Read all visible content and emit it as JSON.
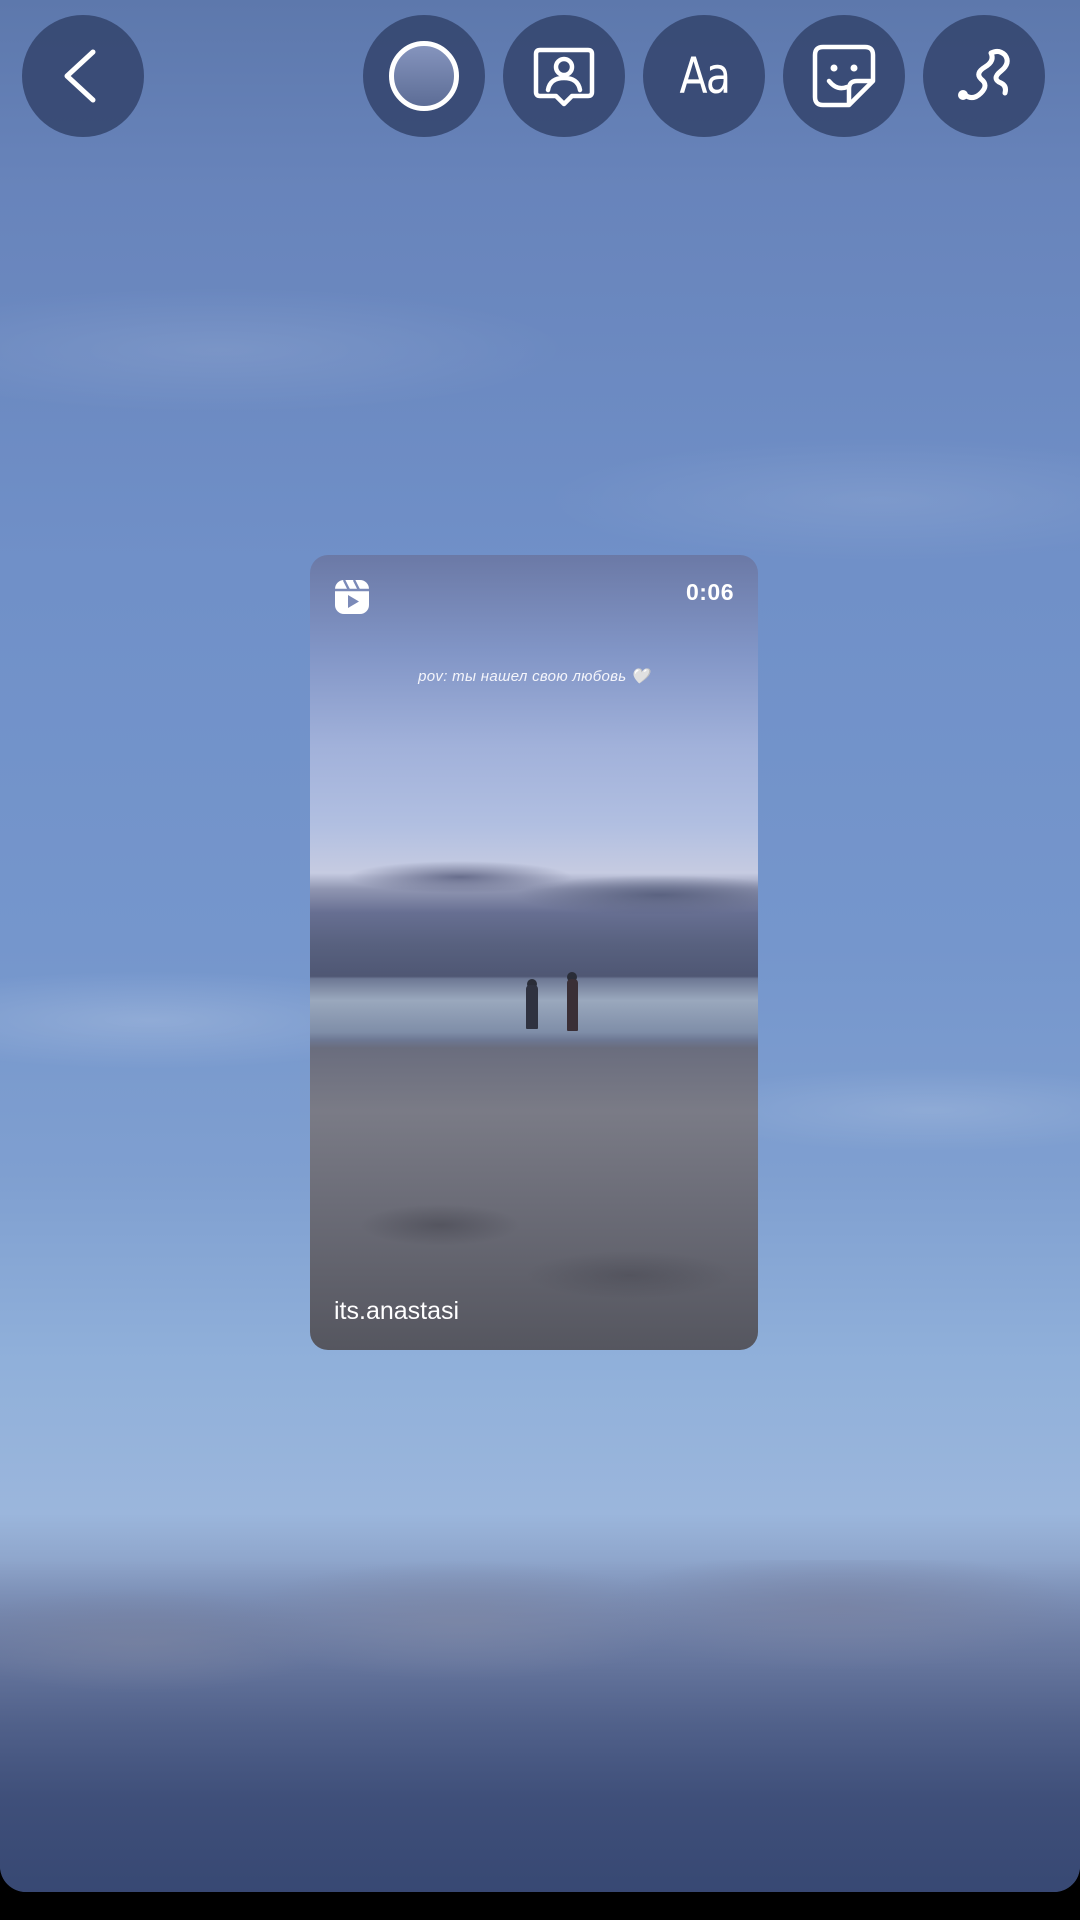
{
  "toolbar": {
    "back": {
      "icon": "chevron-left-icon"
    },
    "color_picker": {
      "icon": "color-circle-icon"
    },
    "mention": {
      "icon": "mention-person-icon"
    },
    "text_tool": {
      "icon": "text-icon",
      "label": "Aa"
    },
    "sticker": {
      "icon": "sticker-icon"
    },
    "draw": {
      "icon": "squiggle-draw-icon"
    }
  },
  "reel_card": {
    "icon": "reels-icon",
    "duration": "0:06",
    "caption": "pov: ты нашел свою любовь 🤍",
    "username": "its.anastasi"
  },
  "colors": {
    "button_bg": "#34466e",
    "sky_top": "#5d78ac",
    "sky_bottom": "#3a4c7c"
  }
}
